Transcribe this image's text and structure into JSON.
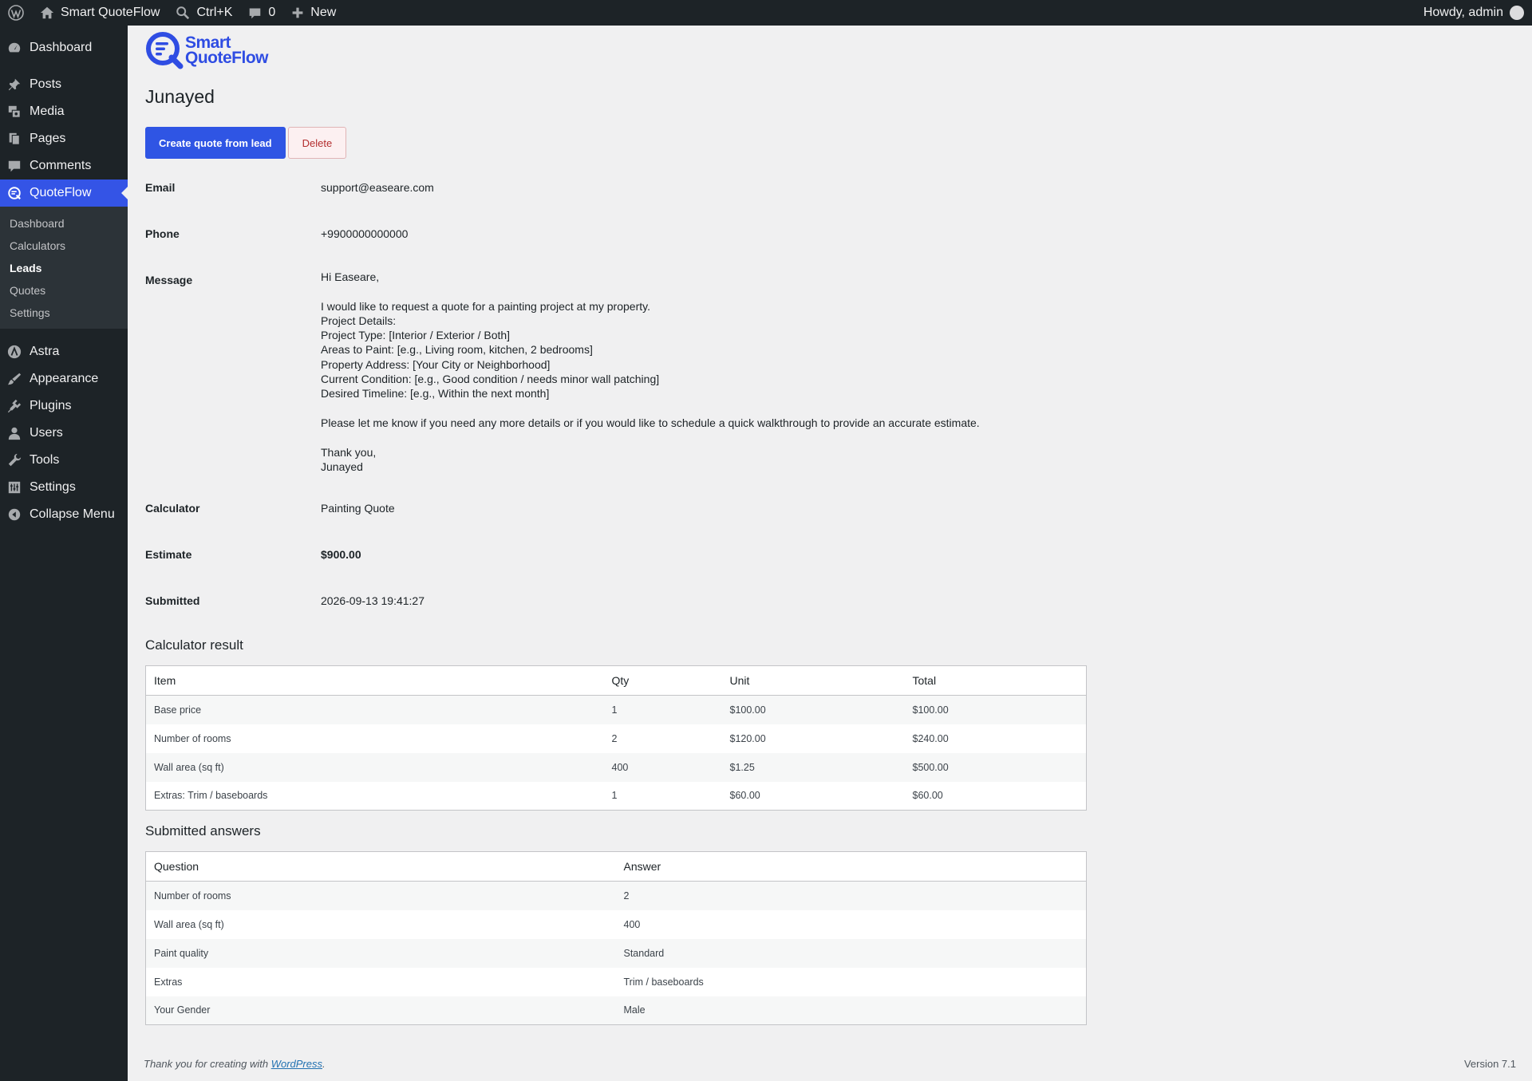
{
  "adminbar": {
    "site_name": "Smart QuoteFlow",
    "search_shortcut": "Ctrl+K",
    "comments_count": "0",
    "new_label": "New",
    "greeting": "Howdy, admin"
  },
  "sidebar": {
    "items_top": [
      {
        "label": "Dashboard",
        "icon": "dashboard-icon"
      }
    ],
    "items_content": [
      {
        "label": "Posts",
        "icon": "pin-icon"
      },
      {
        "label": "Media",
        "icon": "media-icon"
      },
      {
        "label": "Pages",
        "icon": "pages-icon"
      },
      {
        "label": "Comments",
        "icon": "comment-icon"
      }
    ],
    "active_item": {
      "label": "QuoteFlow",
      "icon": "quoteflow-icon"
    },
    "submenu": [
      "Dashboard",
      "Calculators",
      "Leads",
      "Quotes",
      "Settings"
    ],
    "submenu_current": "Leads",
    "items_bottom": [
      {
        "label": "Astra",
        "icon": "astra-icon"
      },
      {
        "label": "Appearance",
        "icon": "brush-icon"
      },
      {
        "label": "Plugins",
        "icon": "plugin-icon"
      },
      {
        "label": "Users",
        "icon": "user-icon"
      },
      {
        "label": "Tools",
        "icon": "wrench-icon"
      },
      {
        "label": "Settings",
        "icon": "settings-icon"
      },
      {
        "label": "Collapse Menu",
        "icon": "collapse-icon"
      }
    ]
  },
  "logo": {
    "line1": "Smart",
    "line2": "QuoteFlow"
  },
  "lead": {
    "name": "Junayed",
    "actions": {
      "create_quote": "Create quote from lead",
      "delete": "Delete"
    },
    "fields": {
      "email": {
        "label": "Email",
        "value": "support@easeare.com"
      },
      "phone": {
        "label": "Phone",
        "value": "+9900000000000"
      },
      "message": {
        "label": "Message",
        "lines": [
          "Hi Easeare,",
          "",
          "I would like to request a quote for a painting project at my property.",
          "Project Details:",
          "Project Type: [Interior / Exterior / Both]",
          "Areas to Paint: [e.g., Living room, kitchen, 2 bedrooms]",
          "Property Address: [Your City or Neighborhood]",
          "Current Condition: [e.g., Good condition / needs minor wall patching]",
          "Desired Timeline: [e.g., Within the next month]",
          "",
          "Please let me know if you need any more details or if you would like to schedule a quick walkthrough to provide an accurate estimate.",
          "",
          "Thank you,",
          "Junayed"
        ]
      },
      "calculator": {
        "label": "Calculator",
        "value": "Painting Quote"
      },
      "estimate": {
        "label": "Estimate",
        "value": "$900.00"
      },
      "submitted": {
        "label": "Submitted",
        "value": "2026-09-13 19:41:27"
      }
    }
  },
  "calculator_result": {
    "title": "Calculator result",
    "headers": [
      "Item",
      "Qty",
      "Unit",
      "Total"
    ],
    "rows": [
      [
        "Base price",
        "1",
        "$100.00",
        "$100.00"
      ],
      [
        "Number of rooms",
        "2",
        "$120.00",
        "$240.00"
      ],
      [
        "Wall area (sq ft)",
        "400",
        "$1.25",
        "$500.00"
      ],
      [
        "Extras: Trim / baseboards",
        "1",
        "$60.00",
        "$60.00"
      ]
    ]
  },
  "submitted_answers": {
    "title": "Submitted answers",
    "headers": [
      "Question",
      "Answer"
    ],
    "rows": [
      [
        "Number of rooms",
        "2"
      ],
      [
        "Wall area (sq ft)",
        "400"
      ],
      [
        "Paint quality",
        "Standard"
      ],
      [
        "Extras",
        "Trim / baseboards"
      ],
      [
        "Your Gender",
        "Male"
      ]
    ]
  },
  "footer": {
    "thanks_prefix": "Thank you for creating with ",
    "link": "WordPress",
    "suffix": ".",
    "version": "Version 7.1"
  }
}
